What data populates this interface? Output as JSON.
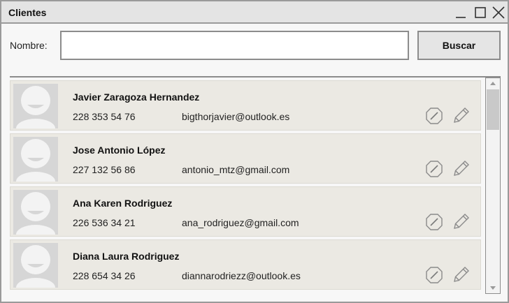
{
  "window": {
    "title": "Clientes"
  },
  "search": {
    "label": "Nombre:",
    "value": "",
    "placeholder": "",
    "button_label": "Buscar"
  },
  "clients": [
    {
      "name": "Javier Zaragoza Hernandez",
      "phone": "228 353 54 76",
      "email": "bigthorjavier@outlook.es"
    },
    {
      "name": "Jose Antonio López",
      "phone": "227 132 56 86",
      "email": "antonio_mtz@gmail.com"
    },
    {
      "name": "Ana Karen Rodriguez",
      "phone": "226 536 34 21",
      "email": "ana_rodriguez@gmail.com"
    },
    {
      "name": "Diana Laura Rodriguez",
      "phone": "228 654 34 26",
      "email": "diannarodriezz@outlook.es"
    }
  ],
  "icons": {
    "row_actions": [
      "block-icon",
      "pencil-icon"
    ],
    "avatar": "user-placeholder-icon"
  }
}
